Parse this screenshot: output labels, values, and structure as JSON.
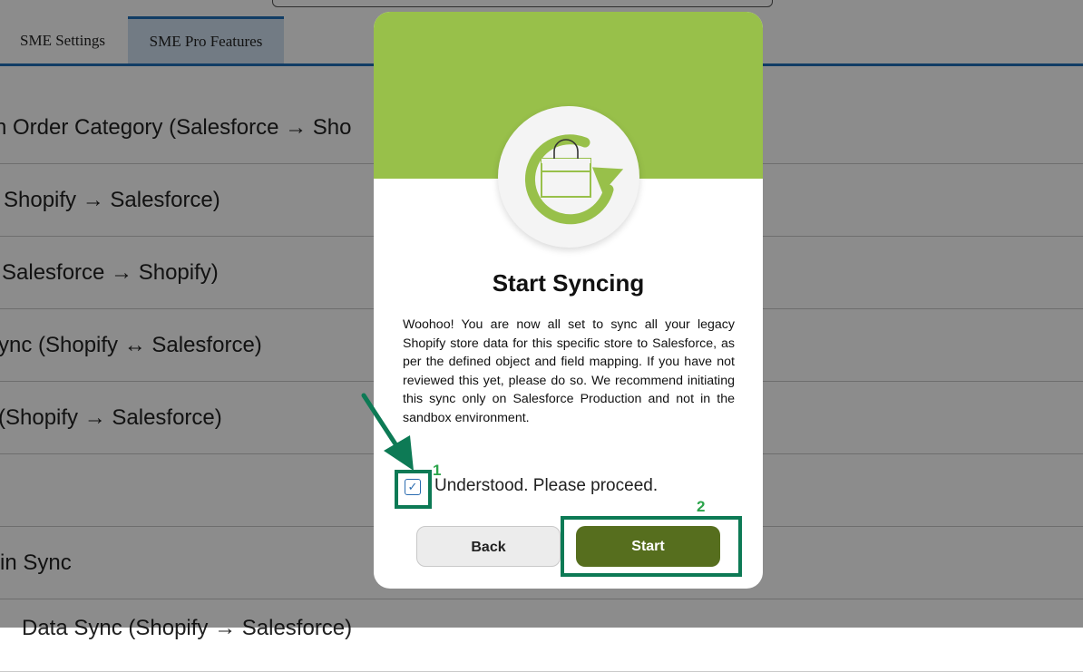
{
  "tabs": [
    {
      "label": "SME Settings"
    },
    {
      "label": "SME Pro Features"
    }
  ],
  "rows": [
    {
      "label": "n Order Category (Salesforce → Sho"
    },
    {
      "label": "Shopify → Salesforce)"
    },
    {
      "label": "Salesforce → Shopify)"
    },
    {
      "label": "ync (Shopify ↔ Salesforce)"
    },
    {
      "label": "(Shopify → Salesforce)"
    },
    {
      "label": ""
    },
    {
      "label": "in Sync"
    },
    {
      "label": "Data Sync (Shopify → Salesforce)"
    }
  ],
  "modal": {
    "title": "Start Syncing",
    "body": "Woohoo! You are now all set to sync all your legacy Shopify store data for this specific store to Salesforce, as per the defined object and field mapping. If you have not reviewed this yet, please do so. We recommend initiating this sync only on Salesforce Production and not in the sandbox environment.",
    "checkbox_label": "Understood. Please proceed.",
    "checkbox_checked": true,
    "back_label": "Back",
    "start_label": "Start"
  },
  "annotations": {
    "step1": "1",
    "step2": "2"
  },
  "colors": {
    "header_green": "#98c04a",
    "start_button": "#566e1e",
    "annotation": "#0d7a55",
    "tab_active": "#1f6fb8"
  }
}
